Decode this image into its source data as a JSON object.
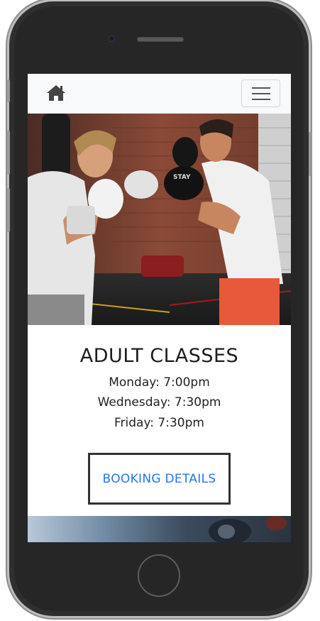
{
  "nav": {
    "home_icon": "home-icon",
    "menu_icon": "hamburger-menu-icon"
  },
  "hero_image": {
    "subject": "boxing-training-photo"
  },
  "section": {
    "title": "ADULT CLASSES",
    "schedule": [
      "Monday: 7:00pm",
      "Wednesday: 7:30pm",
      "Friday: 7:30pm"
    ],
    "button_label": "BOOKING DETAILS"
  },
  "colors": {
    "link_blue": "#1e7ae6",
    "navbar_bg": "#f8f9fa",
    "button_border": "#333333"
  }
}
